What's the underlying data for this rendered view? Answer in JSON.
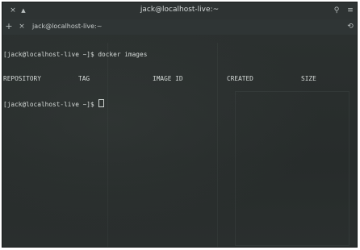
{
  "window": {
    "title": "jack@localhost-live:~"
  },
  "icons": {
    "close": "×",
    "pin": "▲",
    "search": "⚲",
    "menu": "≡",
    "new_tab": "+",
    "tab_close": "×",
    "history": "⟲"
  },
  "tab": {
    "label": "jack@localhost-live:~"
  },
  "terminal": {
    "prompt": "[jack@localhost-live ~]$ ",
    "command": "docker images",
    "headers": [
      "REPOSITORY",
      "TAG",
      "IMAGE ID",
      "CREATED",
      "SIZE"
    ]
  }
}
